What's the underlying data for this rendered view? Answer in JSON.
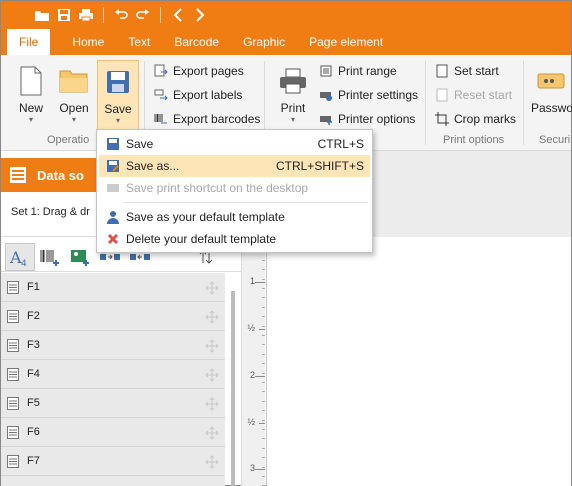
{
  "quick_access": {
    "icons": [
      "open-folder-icon",
      "save-icon",
      "print-icon",
      "undo-icon",
      "redo-icon",
      "back-icon",
      "forward-icon"
    ]
  },
  "tabs": [
    "File",
    "Home",
    "Text",
    "Barcode",
    "Graphic",
    "Page element"
  ],
  "ribbon": {
    "operations": {
      "new": "New",
      "open": "Open",
      "save": "Save",
      "group_label": "Operatio"
    },
    "export": {
      "pages": "Export pages",
      "labels": "Export labels",
      "barcodes": "Export barcodes"
    },
    "print": {
      "print": "Print",
      "range": "Print range",
      "settings": "Printer settings",
      "options": "Printer options",
      "group_label": "Print options"
    },
    "print_opts": {
      "set_start": "Set start",
      "reset_start": "Reset start",
      "crop_marks": "Crop marks"
    },
    "security": {
      "password": "Passwor",
      "group_label": "Securi"
    }
  },
  "save_menu": {
    "items": [
      {
        "label": "Save",
        "shortcut": "CTRL+S"
      },
      {
        "label": "Save as...",
        "shortcut": "CTRL+SHIFT+S"
      },
      {
        "label": "Save print shortcut on the desktop",
        "shortcut": ""
      },
      {
        "label": "Save as your default template",
        "shortcut": ""
      },
      {
        "label": "Delete your default template",
        "shortcut": ""
      }
    ]
  },
  "data_source": {
    "title": "Data so",
    "set_label": "Set 1: Drag & dr"
  },
  "fields": [
    "F1",
    "F2",
    "F3",
    "F4",
    "F5",
    "F6",
    "F7"
  ],
  "ruler": {
    "labels": [
      "1",
      "½",
      "2",
      "½",
      "3"
    ]
  },
  "colors": {
    "accent": "#f07c14",
    "highlight": "#fde5b8",
    "ribbon_bg": "#f4f4f4"
  }
}
